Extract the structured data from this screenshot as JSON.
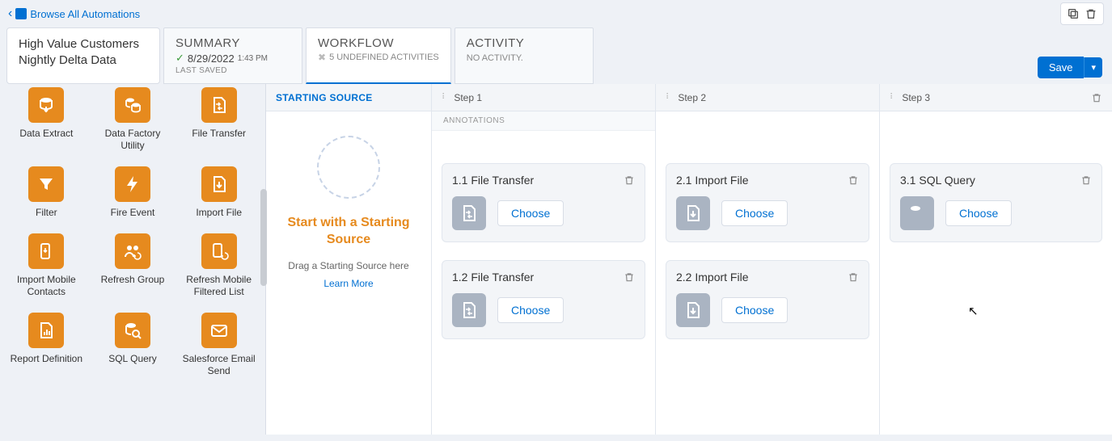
{
  "breadcrumb": {
    "label": "Browse All Automations"
  },
  "title": "High Value Customers Nightly Delta Data",
  "tabs": {
    "summary": {
      "title": "SUMMARY",
      "date": "8/29/2022",
      "time": "1:43 PM",
      "last_saved": "LAST SAVED"
    },
    "workflow": {
      "title": "WORKFLOW",
      "subtitle": "5 UNDEFINED ACTIVITIES"
    },
    "activity": {
      "title": "ACTIVITY",
      "subtitle": "NO ACTIVITY."
    }
  },
  "save_label": "Save",
  "palette": {
    "items": [
      {
        "label": "Data Extract",
        "icon": "data-extract-icon"
      },
      {
        "label": "Data Factory Utility",
        "icon": "data-factory-icon"
      },
      {
        "label": "File Transfer",
        "icon": "file-transfer-icon"
      },
      {
        "label": "Filter",
        "icon": "filter-icon"
      },
      {
        "label": "Fire Event",
        "icon": "fire-event-icon"
      },
      {
        "label": "Import File",
        "icon": "import-file-icon"
      },
      {
        "label": "Import Mobile Contacts",
        "icon": "import-mobile-icon"
      },
      {
        "label": "Refresh Group",
        "icon": "refresh-group-icon"
      },
      {
        "label": "Refresh Mobile Filtered List",
        "icon": "refresh-mobile-icon"
      },
      {
        "label": "Report Definition",
        "icon": "report-def-icon"
      },
      {
        "label": "SQL Query",
        "icon": "sql-query-icon"
      },
      {
        "label": "Salesforce Email Send",
        "icon": "email-send-icon"
      }
    ]
  },
  "canvas": {
    "source": {
      "header": "STARTING SOURCE",
      "title": "Start with a Starting Source",
      "hint": "Drag a Starting Source here",
      "learn_more": "Learn More"
    },
    "annotations_label": "ANNOTATIONS",
    "choose_label": "Choose",
    "steps": [
      {
        "label": "Step 1",
        "activities": [
          {
            "title": "1.1 File Transfer",
            "icon": "file-transfer-icon"
          },
          {
            "title": "1.2 File Transfer",
            "icon": "file-transfer-icon"
          }
        ]
      },
      {
        "label": "Step 2",
        "activities": [
          {
            "title": "2.1 Import File",
            "icon": "import-file-icon"
          },
          {
            "title": "2.2 Import File",
            "icon": "import-file-icon"
          }
        ]
      },
      {
        "label": "Step 3",
        "activities": [
          {
            "title": "3.1 SQL Query",
            "icon": "sql-query-icon"
          }
        ]
      }
    ]
  }
}
